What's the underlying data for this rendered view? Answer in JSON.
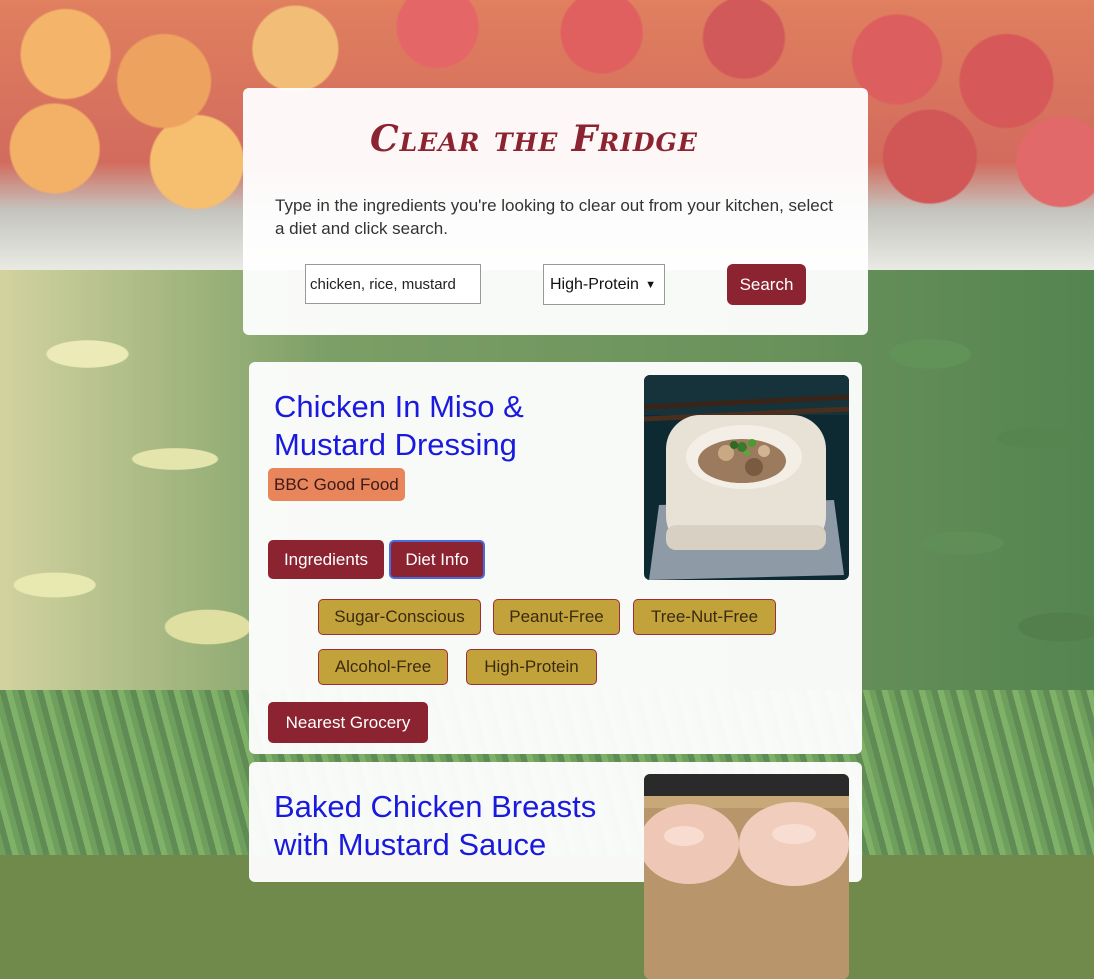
{
  "app": {
    "title": "Clear the Fridge",
    "instructions": "Type in the ingredients you're looking to clear out from your kitchen, select a diet and click search."
  },
  "search": {
    "value": "chicken, rice, mustard",
    "diet_selected": "High-Protein",
    "button_label": "Search"
  },
  "recipes": [
    {
      "title": "Chicken In Miso & Mustard Dressing",
      "source": "BBC Good Food",
      "tabs": [
        "Ingredients",
        "Diet Info"
      ],
      "diet_tags": [
        "Sugar-Conscious",
        "Peanut-Free",
        "Tree-Nut-Free",
        "Alcohol-Free",
        "High-Protein"
      ],
      "grocery_label": "Nearest Grocery"
    },
    {
      "title": "Baked Chicken Breasts with Mustard Sauce"
    }
  ],
  "colors": {
    "accent": "#8b2430",
    "link": "#1a1adf",
    "source_badge": "#e8855b",
    "diet_tag": "#c2a23a"
  }
}
